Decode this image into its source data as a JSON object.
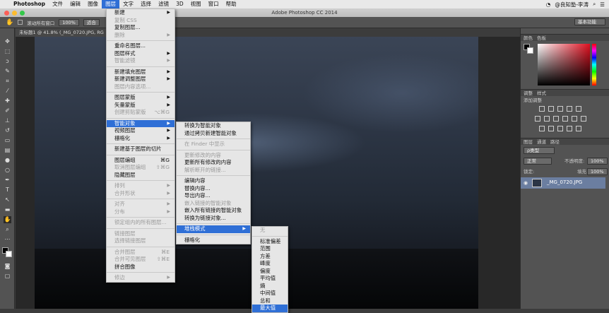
{
  "menubar": {
    "apple": "",
    "items": [
      "Photoshop",
      "文件",
      "编辑",
      "图像",
      "图层",
      "文字",
      "选择",
      "滤镜",
      "3D",
      "视图",
      "窗口",
      "帮助"
    ],
    "active_index": 4,
    "user": "@良知塾-李涛"
  },
  "window": {
    "title": "Adobe Photoshop CC 2014"
  },
  "options": {
    "scroll_all": "滚动所有窗口",
    "zoom": "100%",
    "fit": "适合",
    "workspace": "基本功能"
  },
  "document": {
    "tab": "未标题1 @ 41.8% (_MG_0720.JPG, RG"
  },
  "colors": {
    "accent": "#2f6fd6",
    "menu_bg": "#e6e6e6",
    "panel_bg": "#535353"
  },
  "layer_menu": [
    {
      "label": "新建",
      "arrow": true
    },
    {
      "label": "复制 CSS",
      "disabled": true
    },
    {
      "label": "复制图层..."
    },
    {
      "label": "删除",
      "arrow": true,
      "disabled": true
    },
    {
      "sep": true
    },
    {
      "label": "重命名图层..."
    },
    {
      "label": "图层样式",
      "arrow": true
    },
    {
      "label": "智能滤镜",
      "arrow": true,
      "disabled": true
    },
    {
      "sep": true
    },
    {
      "label": "新建填充图层",
      "arrow": true
    },
    {
      "label": "新建调整图层",
      "arrow": true
    },
    {
      "label": "图层内容选项...",
      "disabled": true
    },
    {
      "sep": true
    },
    {
      "label": "图层蒙版",
      "arrow": true
    },
    {
      "label": "矢量蒙版",
      "arrow": true
    },
    {
      "label": "创建剪贴蒙版",
      "shortcut": "⌥⌘G",
      "disabled": true
    },
    {
      "sep": true
    },
    {
      "label": "智能对象",
      "arrow": true,
      "highlight": true
    },
    {
      "label": "视频图层",
      "arrow": true
    },
    {
      "label": "栅格化",
      "arrow": true
    },
    {
      "sep": true
    },
    {
      "label": "新建基于图层的切片"
    },
    {
      "sep": true
    },
    {
      "label": "图层编组",
      "shortcut": "⌘G"
    },
    {
      "label": "取消图层编组",
      "shortcut": "⇧⌘G",
      "disabled": true
    },
    {
      "label": "隐藏图层"
    },
    {
      "sep": true
    },
    {
      "label": "排列",
      "arrow": true,
      "disabled": true
    },
    {
      "label": "合并形状",
      "arrow": true,
      "disabled": true
    },
    {
      "sep": true
    },
    {
      "label": "对齐",
      "arrow": true,
      "disabled": true
    },
    {
      "label": "分布",
      "arrow": true,
      "disabled": true
    },
    {
      "sep": true
    },
    {
      "label": "锁定组内的所有图层...",
      "disabled": true
    },
    {
      "sep": true
    },
    {
      "label": "链接图层",
      "disabled": true
    },
    {
      "label": "选择链接图层",
      "disabled": true
    },
    {
      "sep": true
    },
    {
      "label": "合并图层",
      "shortcut": "⌘E",
      "disabled": true
    },
    {
      "label": "合并可见图层",
      "shortcut": "⇧⌘E",
      "disabled": true
    },
    {
      "label": "拼合图像"
    },
    {
      "sep": true
    },
    {
      "label": "修边",
      "arrow": true,
      "disabled": true
    }
  ],
  "smart_menu": [
    {
      "label": "转换为智能对象"
    },
    {
      "label": "通过拷贝新建智能对象"
    },
    {
      "sep": true
    },
    {
      "label": "在 Finder 中显示",
      "disabled": true
    },
    {
      "sep": true
    },
    {
      "label": "更新修改的内容",
      "disabled": true
    },
    {
      "label": "更新所有修改的内容"
    },
    {
      "label": "解析断开的链接...",
      "disabled": true
    },
    {
      "sep": true
    },
    {
      "label": "编辑内容"
    },
    {
      "label": "替换内容..."
    },
    {
      "label": "导出内容..."
    },
    {
      "label": "嵌入链接的智能对象",
      "disabled": true
    },
    {
      "label": "嵌入所有链接的智能对象"
    },
    {
      "label": "转换为链接对象..."
    },
    {
      "sep": true
    },
    {
      "label": "堆栈模式",
      "arrow": true,
      "highlight": true
    },
    {
      "sep": true
    },
    {
      "label": "栅格化"
    }
  ],
  "stack_menu": [
    {
      "label": "无",
      "disabled": true
    },
    {
      "sep": true
    },
    {
      "label": "标准偏差"
    },
    {
      "label": "范围"
    },
    {
      "label": "方差"
    },
    {
      "label": "峰度"
    },
    {
      "label": "偏度"
    },
    {
      "label": "平均值"
    },
    {
      "label": "熵"
    },
    {
      "label": "中间值"
    },
    {
      "label": "总和"
    },
    {
      "label": "最大值",
      "highlight": true
    }
  ],
  "panels": {
    "color_tabs": [
      "颜色",
      "色板"
    ],
    "adjust_tabs": [
      "调整",
      "样式"
    ],
    "add_adjustment": "添加调整",
    "layers_tabs": [
      "图层",
      "通道",
      "路径"
    ],
    "kind": "ρ类型",
    "blend": "正常",
    "opacity_label": "不透明度:",
    "opacity": "100%",
    "lock_label": "锁定:",
    "fill_label": "填充:",
    "fill": "100%",
    "layer_name": "_MG_0720.JPG"
  }
}
